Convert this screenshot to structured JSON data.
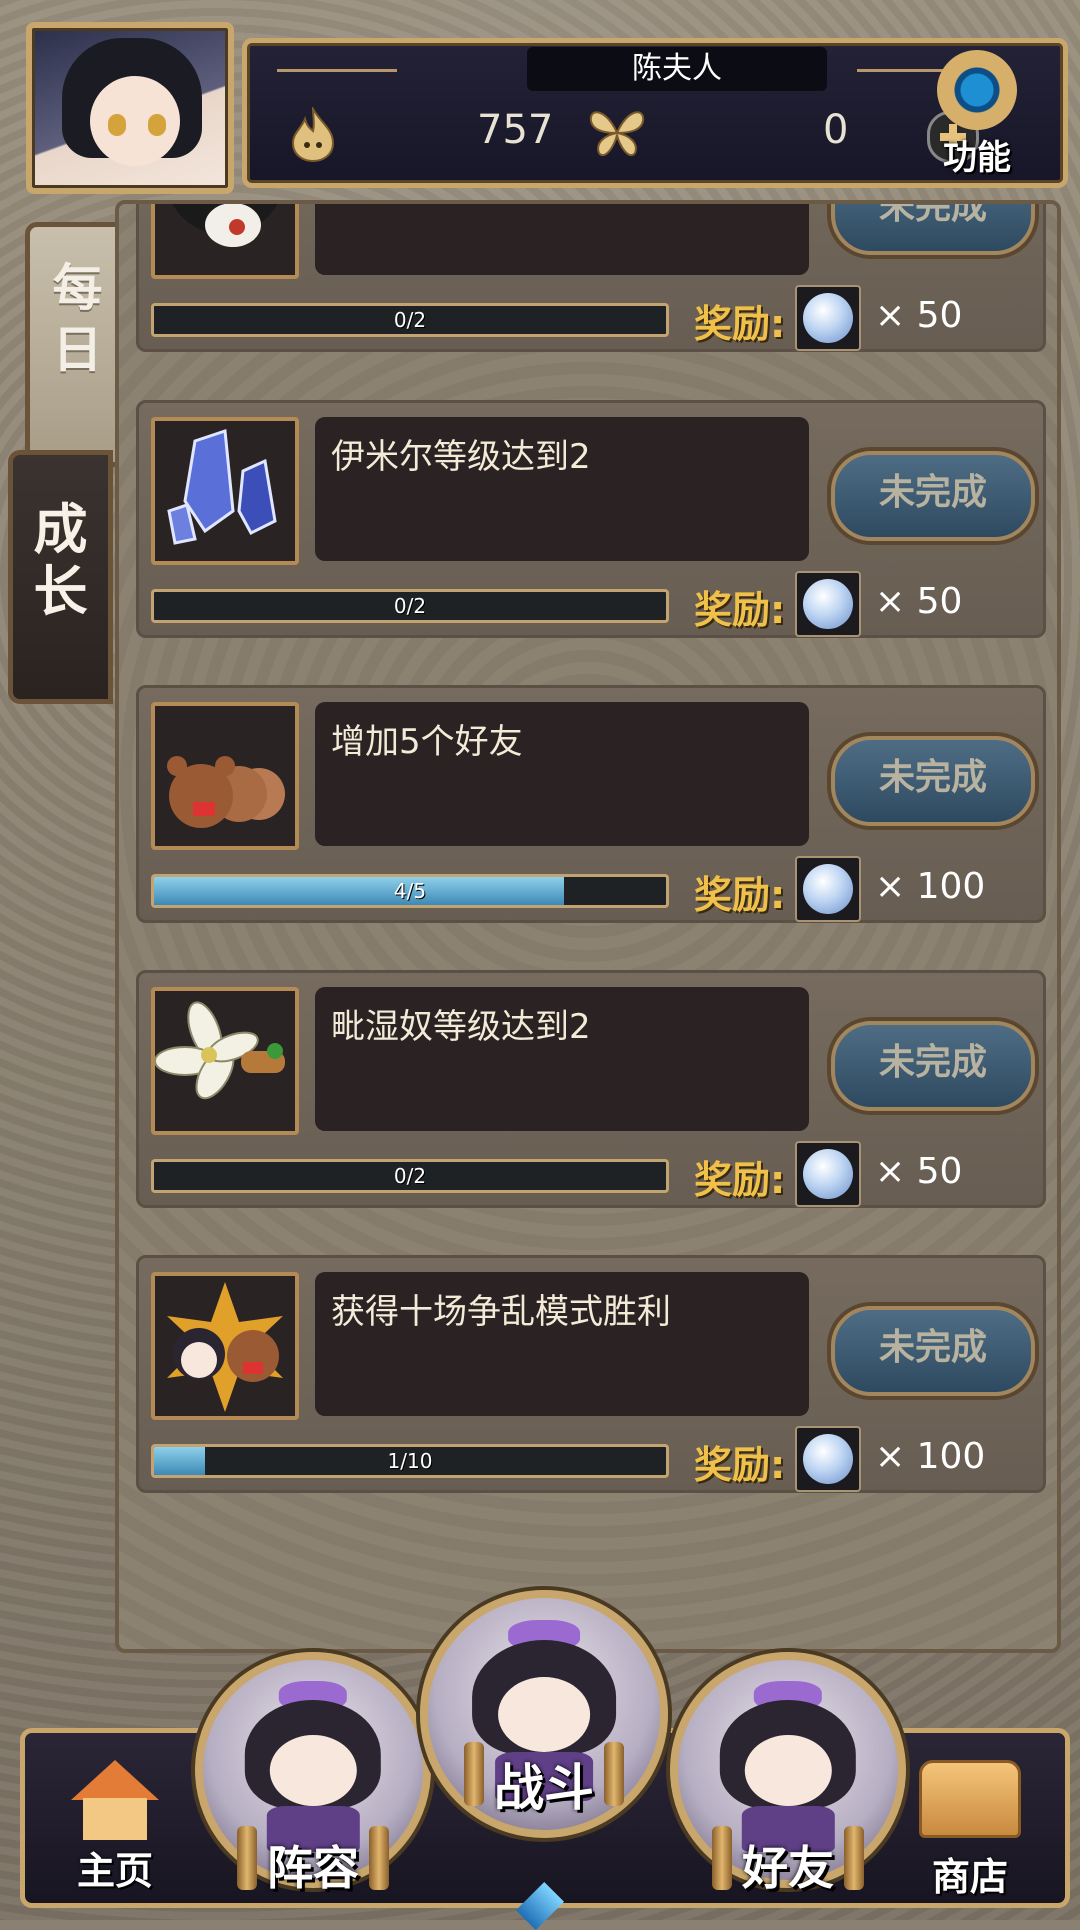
{
  "header": {
    "player_name": "陈夫人",
    "currency1_value": "757",
    "currency2_value": "0",
    "function_label": "功能"
  },
  "tabs": {
    "daily": "每日",
    "growth": "成长"
  },
  "tasks": [
    {
      "title": "",
      "progress_text": "0/2",
      "progress_fraction": 0.0,
      "status": "未完成",
      "reward_label": "奖励:",
      "reward_qty": "× 50"
    },
    {
      "title": "伊米尔等级达到2",
      "progress_text": "0/2",
      "progress_fraction": 0.0,
      "status": "未完成",
      "reward_label": "奖励:",
      "reward_qty": "× 50"
    },
    {
      "title": "增加5个好友",
      "progress_text": "4/5",
      "progress_fraction": 0.8,
      "status": "未完成",
      "reward_label": "奖励:",
      "reward_qty": "× 100"
    },
    {
      "title": "毗湿奴等级达到2",
      "progress_text": "0/2",
      "progress_fraction": 0.0,
      "status": "未完成",
      "reward_label": "奖励:",
      "reward_qty": "× 50"
    },
    {
      "title": "获得十场争乱模式胜利",
      "progress_text": "1/10",
      "progress_fraction": 0.1,
      "status": "未完成",
      "reward_label": "奖励:",
      "reward_qty": "× 100"
    }
  ],
  "bottom_nav": {
    "home": "主页",
    "lineup": "阵容",
    "battle": "战斗",
    "friends": "好友",
    "shop": "商店"
  }
}
